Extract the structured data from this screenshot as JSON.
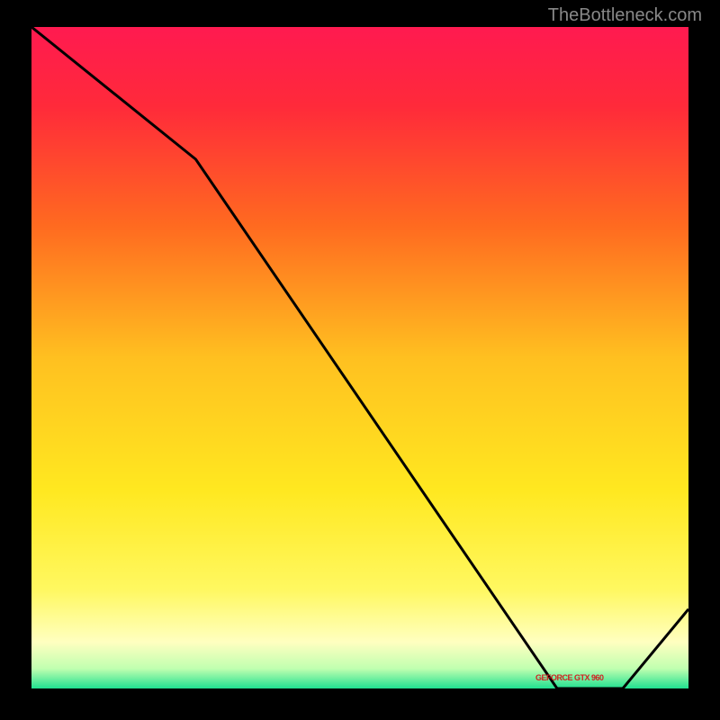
{
  "attribution": "TheBottleneck.com",
  "chart_data": {
    "type": "line",
    "title": "",
    "xlabel": "",
    "ylabel": "",
    "xlim": [
      0,
      100
    ],
    "ylim": [
      0,
      100
    ],
    "x": [
      0,
      25,
      80,
      90,
      100
    ],
    "values": [
      100,
      80,
      0,
      0,
      12
    ],
    "gradient_stops": [
      {
        "pos": 0.0,
        "color": "#ff1a50"
      },
      {
        "pos": 0.12,
        "color": "#ff2a3a"
      },
      {
        "pos": 0.3,
        "color": "#ff6a20"
      },
      {
        "pos": 0.5,
        "color": "#ffc020"
      },
      {
        "pos": 0.7,
        "color": "#ffe820"
      },
      {
        "pos": 0.85,
        "color": "#fff860"
      },
      {
        "pos": 0.93,
        "color": "#ffffc0"
      },
      {
        "pos": 0.97,
        "color": "#c0ffb0"
      },
      {
        "pos": 1.0,
        "color": "#20e090"
      }
    ],
    "annotation": "GEFORCE GTX 960"
  },
  "annotation_label": "GEFORCE GTX 960"
}
